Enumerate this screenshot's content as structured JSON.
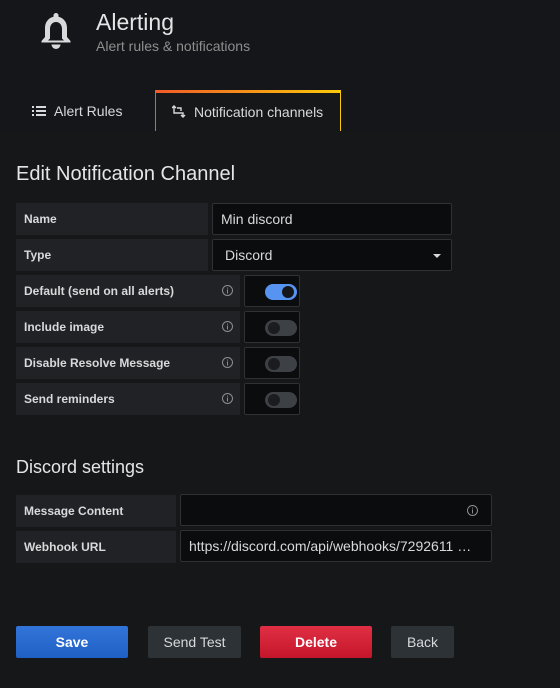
{
  "header": {
    "title": "Alerting",
    "subtitle": "Alert rules & notifications",
    "icon": "bell-icon"
  },
  "tabs": [
    {
      "label": "Alert Rules",
      "icon": "list-icon",
      "active": false
    },
    {
      "label": "Notification channels",
      "icon": "notification-channel-icon",
      "active": true
    }
  ],
  "form": {
    "title": "Edit Notification Channel",
    "name_label": "Name",
    "name_value": "Min discord",
    "type_label": "Type",
    "type_value": "Discord",
    "toggles": [
      {
        "label": "Default (send on all alerts)",
        "on": true
      },
      {
        "label": "Include image",
        "on": false
      },
      {
        "label": "Disable Resolve Message",
        "on": false
      },
      {
        "label": "Send reminders",
        "on": false
      }
    ]
  },
  "discord": {
    "title": "Discord settings",
    "message_label": "Message Content",
    "message_value": "",
    "webhook_label": "Webhook URL",
    "webhook_value": "https://discord.com/api/webhooks/7292611 …"
  },
  "buttons": {
    "save": "Save",
    "test": "Send Test",
    "delete": "Delete",
    "back": "Back"
  },
  "colors": {
    "primary": "#3274d9",
    "danger": "#e02f44",
    "toggle_on": "#5794f2",
    "tab_accent": "#f05a28"
  }
}
